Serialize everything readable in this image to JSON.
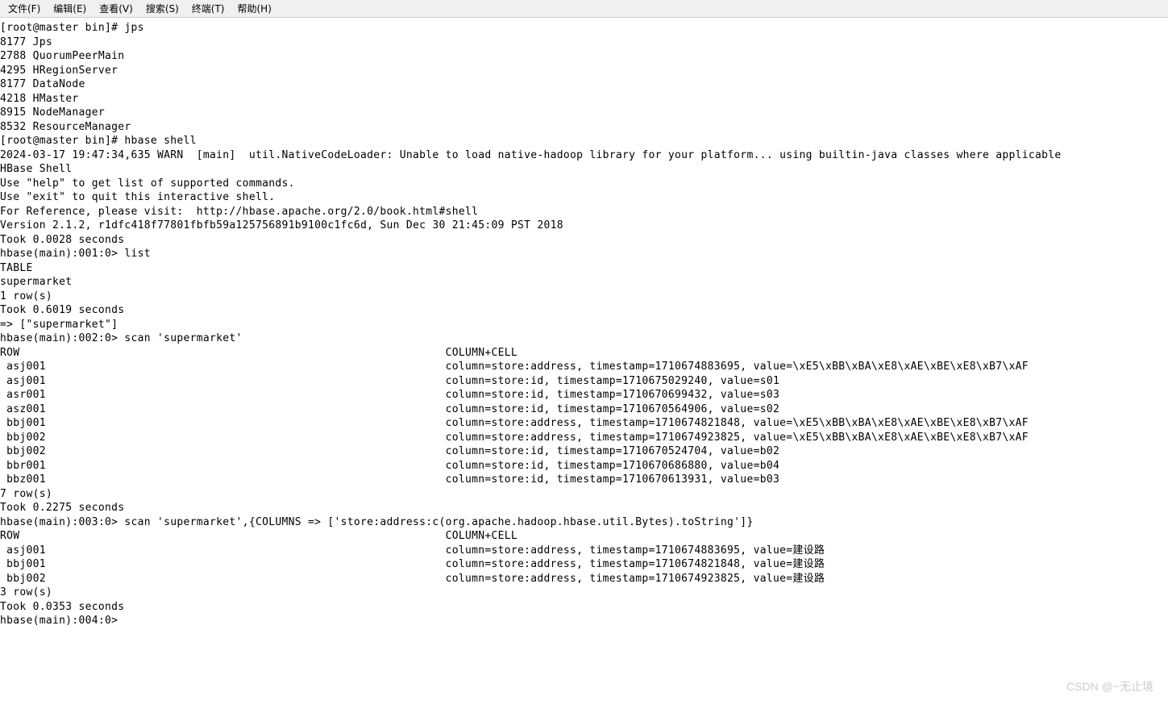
{
  "menubar": {
    "file": "文件(F)",
    "edit": "编辑(E)",
    "view": "查看(V)",
    "search": "搜索(S)",
    "terminal": "终端(T)",
    "help": "帮助(H)"
  },
  "terminal": {
    "lines": [
      "[root@master bin]# jps",
      "8177 Jps",
      "2788 QuorumPeerMain",
      "4295 HRegionServer",
      "8177 DataNode",
      "4218 HMaster",
      "8915 NodeManager",
      "8532 ResourceManager",
      "[root@master bin]# hbase shell",
      "2024-03-17 19:47:34,635 WARN  [main]  util.NativeCodeLoader: Unable to load native-hadoop library for your platform... using builtin-java classes where applicable",
      "HBase Shell",
      "Use \"help\" to get list of supported commands.",
      "Use \"exit\" to quit this interactive shell.",
      "For Reference, please visit:  http://hbase.apache.org/2.0/book.html#shell",
      "Version 2.1.2, r1dfc418f77801fbfb59a125756891b9100c1fc6d, Sun Dec 30 21:45:09 PST 2018",
      "Took 0.0028 seconds",
      "hbase(main):001:0> list",
      "TABLE",
      "supermarket",
      "1 row(s)",
      "Took 0.6019 seconds",
      "=> [\"supermarket\"]",
      "hbase(main):002:0> scan 'supermarket'",
      "ROW                                                                 COLUMN+CELL",
      " asj001                                                             column=store:address, timestamp=1710674883695, value=\\xE5\\xBB\\xBA\\xE8\\xAE\\xBE\\xE8\\xB7\\xAF",
      " asj001                                                             column=store:id, timestamp=1710675029240, value=s01",
      " asr001                                                             column=store:id, timestamp=1710670699432, value=s03",
      " asz001                                                             column=store:id, timestamp=1710670564906, value=s02",
      " bbj001                                                             column=store:address, timestamp=1710674821848, value=\\xE5\\xBB\\xBA\\xE8\\xAE\\xBE\\xE8\\xB7\\xAF",
      " bbj002                                                             column=store:address, timestamp=1710674923825, value=\\xE5\\xBB\\xBA\\xE8\\xAE\\xBE\\xE8\\xB7\\xAF",
      " bbj002                                                             column=store:id, timestamp=1710670524704, value=b02",
      " bbr001                                                             column=store:id, timestamp=1710670686880, value=b04",
      " bbz001                                                             column=store:id, timestamp=1710670613931, value=b03",
      "7 row(s)",
      "Took 0.2275 seconds",
      "hbase(main):003:0> scan 'supermarket',{COLUMNS => ['store:address:c(org.apache.hadoop.hbase.util.Bytes).toString']}",
      "ROW                                                                 COLUMN+CELL",
      " asj001                                                             column=store:address, timestamp=1710674883695, value=建设路",
      "",
      " bbj001                                                             column=store:address, timestamp=1710674821848, value=建设路",
      "",
      " bbj002                                                             column=store:address, timestamp=1710674923825, value=建设路",
      "",
      "3 row(s)",
      "Took 0.0353 seconds",
      "hbase(main):004:0>"
    ]
  },
  "watermark": "CSDN @~无止境"
}
